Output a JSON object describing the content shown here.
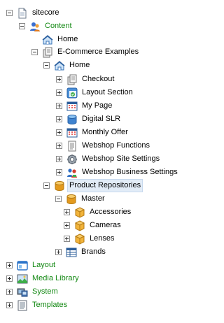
{
  "tree": {
    "root": "sitecore",
    "content": "Content",
    "home1": "Home",
    "ecommerce": "E-Commerce Examples",
    "home2": "Home",
    "checkout": "Checkout",
    "layout_section": "Layout Section",
    "my_page": "My Page",
    "digital_slr": "Digital SLR",
    "monthly_offer": "Monthly Offer",
    "webshop_functions": "Webshop Functions",
    "webshop_site_settings": "Webshop Site Settings",
    "webshop_business_settings": "Webshop Business Settings",
    "product_repositories": "Product Repositories",
    "master": "Master",
    "accessories": "Accessories",
    "cameras": "Cameras",
    "lenses": "Lenses",
    "brands": "Brands",
    "layout": "Layout",
    "media_library": "Media Library",
    "system": "System",
    "templates": "Templates"
  },
  "colors": {
    "green_label": "#128812",
    "selection": "#e2ecf7"
  }
}
